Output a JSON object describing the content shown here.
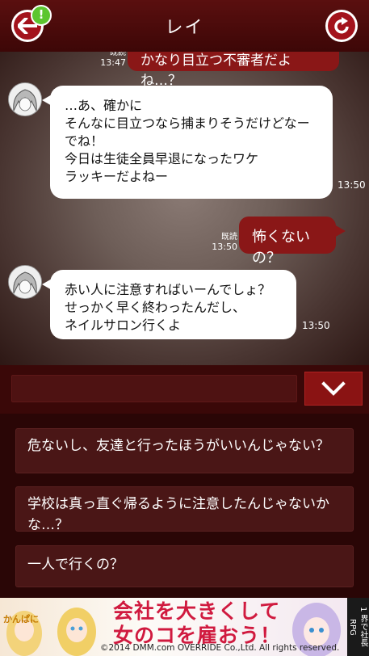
{
  "header": {
    "title": "レイ",
    "notify_badge": "!"
  },
  "chat": {
    "messages": [
      {
        "from": "me",
        "text": "かなり目立つ不審者だよね…？",
        "read": "既読",
        "time": "13:47"
      },
      {
        "from": "rei",
        "text": "…あ、確かに\nそんなに目立つなら捕まりそうだけどなー\nでね！\n今日は生徒全員早退になったワケ\nラッキーだよねー",
        "time": "13:50"
      },
      {
        "from": "me",
        "text": "怖くないの？",
        "read": "既読",
        "time": "13:50"
      },
      {
        "from": "rei",
        "text": "赤い人に注意すればいーんでしょ？\nせっかく早く終わったんだし、\nネイルサロン行くよ",
        "time": "13:50"
      }
    ]
  },
  "reply_options": [
    "危ないし、友達と行ったほうがいいんじゃない？",
    "学校は真っ直ぐ帰るように注意したんじゃないかな…？",
    "一人で行くの？"
  ],
  "ad": {
    "headline_line1": "会社を大きくして",
    "headline_line2": "女のコを雇おう！",
    "copyright": "©2014 DMM.com OVERRIDE Co.,Ltd. All rights reserved.",
    "left_logo": "かんぱに",
    "side_label": "1 界で社長 RPG"
  },
  "colors": {
    "header": "#4a0a0a",
    "accent_red": "#a3131c",
    "bubble_red": "#8a1717",
    "badge_green": "#5cc62f"
  },
  "icons": {
    "back": "arrow-left-icon",
    "reload": "reload-icon",
    "toggle": "chevron-down-icon"
  }
}
